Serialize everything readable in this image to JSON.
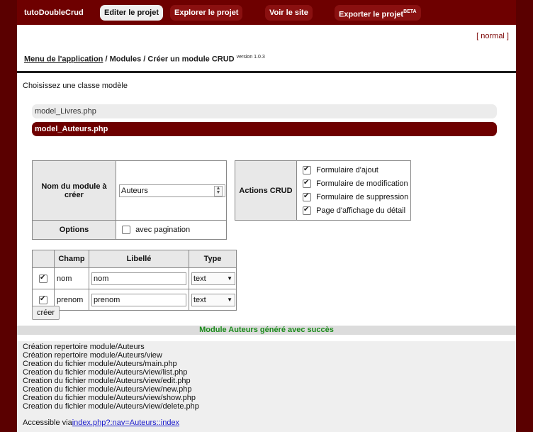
{
  "topbar": {
    "brand": "tutoDoubleCrud",
    "nav": [
      {
        "label": "Editer le projet",
        "active": true
      },
      {
        "label": "Explorer le projet",
        "active": false
      },
      {
        "label": "Voir le site",
        "active": false
      },
      {
        "label": "Exporter le projet",
        "sup": "BETA",
        "active": false
      }
    ]
  },
  "mode_link": "[ normal ]",
  "breadcrumb": {
    "link": "Menu de l'application",
    "rest": " / Modules / Créer un module CRUD ",
    "version": "version 1.0.3"
  },
  "choose_label": "Choisissez une classe modèle",
  "models": [
    {
      "label": "model_Livres.php",
      "selected": false
    },
    {
      "label": "model_Auteurs.php",
      "selected": true
    }
  ],
  "module_form": {
    "name_label": "Nom du module à créer",
    "name_value": "Auteurs",
    "options_label": "Options",
    "pagination_label": "avec pagination",
    "pagination_checked": false
  },
  "actions": {
    "label": "Actions CRUD",
    "items": [
      {
        "label": "Formulaire d'ajout",
        "checked": true
      },
      {
        "label": "Formulaire de modification",
        "checked": true
      },
      {
        "label": "Formulaire de suppression",
        "checked": true
      },
      {
        "label": "Page d'affichage du détail",
        "checked": true
      }
    ]
  },
  "fields": {
    "headers": [
      "",
      "Champ",
      "Libellé",
      "Type"
    ],
    "rows": [
      {
        "checked": true,
        "champ": "nom",
        "libelle": "nom",
        "type": "text"
      },
      {
        "checked": true,
        "champ": "prenom",
        "libelle": "prenom",
        "type": "text"
      }
    ]
  },
  "create_button": "créer",
  "success_message": "Module Auteurs généré avec succès",
  "log_lines": [
    "Création repertoire module/Auteurs",
    "Création repertoire module/Auteurs/view",
    "Creation du fichier module/Auteurs/main.php",
    "Creation du fichier module/Auteurs/view/list.php",
    "Creation du fichier module/Auteurs/view/edit.php",
    "Creation du fichier module/Auteurs/view/new.php",
    "Creation du fichier module/Auteurs/view/show.php",
    "Creation du fichier module/Auteurs/view/delete.php"
  ],
  "accessible": {
    "prefix": "Accessible via",
    "link": "index.php?:nav=Auteurs::index"
  }
}
